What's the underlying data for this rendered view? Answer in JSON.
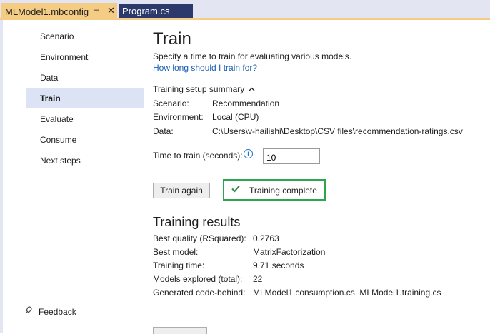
{
  "tabs": {
    "active": {
      "label": "MLModel1.mbconfig",
      "pin": "⊣",
      "close": "✕"
    },
    "inactive": {
      "label": "Program.cs"
    }
  },
  "nav": {
    "items": [
      {
        "label": "Scenario"
      },
      {
        "label": "Environment"
      },
      {
        "label": "Data"
      },
      {
        "label": "Train"
      },
      {
        "label": "Evaluate"
      },
      {
        "label": "Consume"
      },
      {
        "label": "Next steps"
      }
    ],
    "selected_index": 3,
    "feedback_label": "Feedback"
  },
  "main": {
    "title": "Train",
    "subtitle": "Specify a time to train for evaluating various models.",
    "help_link": "How long should I train for?",
    "summary": {
      "header": "Training setup summary",
      "rows": [
        {
          "label": "Scenario:",
          "value": "Recommendation"
        },
        {
          "label": "Environment:",
          "value": "Local (CPU)"
        },
        {
          "label": "Data:",
          "value": "C:\\Users\\v-hailishi\\Desktop\\CSV files\\recommendation-ratings.csv"
        }
      ]
    },
    "time_to_train": {
      "label": "Time to train (seconds):",
      "value": "10"
    },
    "train_button": "Train again",
    "status": "Training complete",
    "results": {
      "title": "Training results",
      "rows": [
        {
          "label": "Best quality (RSquared):",
          "value": "0.2763"
        },
        {
          "label": "Best model:",
          "value": "MatrixFactorization"
        },
        {
          "label": "Training time:",
          "value": "9.71 seconds"
        },
        {
          "label": "Models explored (total):",
          "value": "22"
        },
        {
          "label": "Generated code-behind:",
          "value": "MLModel1.consumption.cs, MLModel1.training.cs"
        }
      ]
    }
  },
  "icons": {
    "pin": "pin-icon",
    "close": "close-icon",
    "chevron": "chevron-up-icon",
    "info": "info-icon",
    "check": "checkmark-icon",
    "feedback": "feedback-icon"
  },
  "colors": {
    "active_tab": "#f5cc84",
    "inactive_tab": "#2b3a6b",
    "link": "#1a5fb4",
    "success_border": "#2ea44f",
    "nav_selected": "#dce3f5"
  }
}
